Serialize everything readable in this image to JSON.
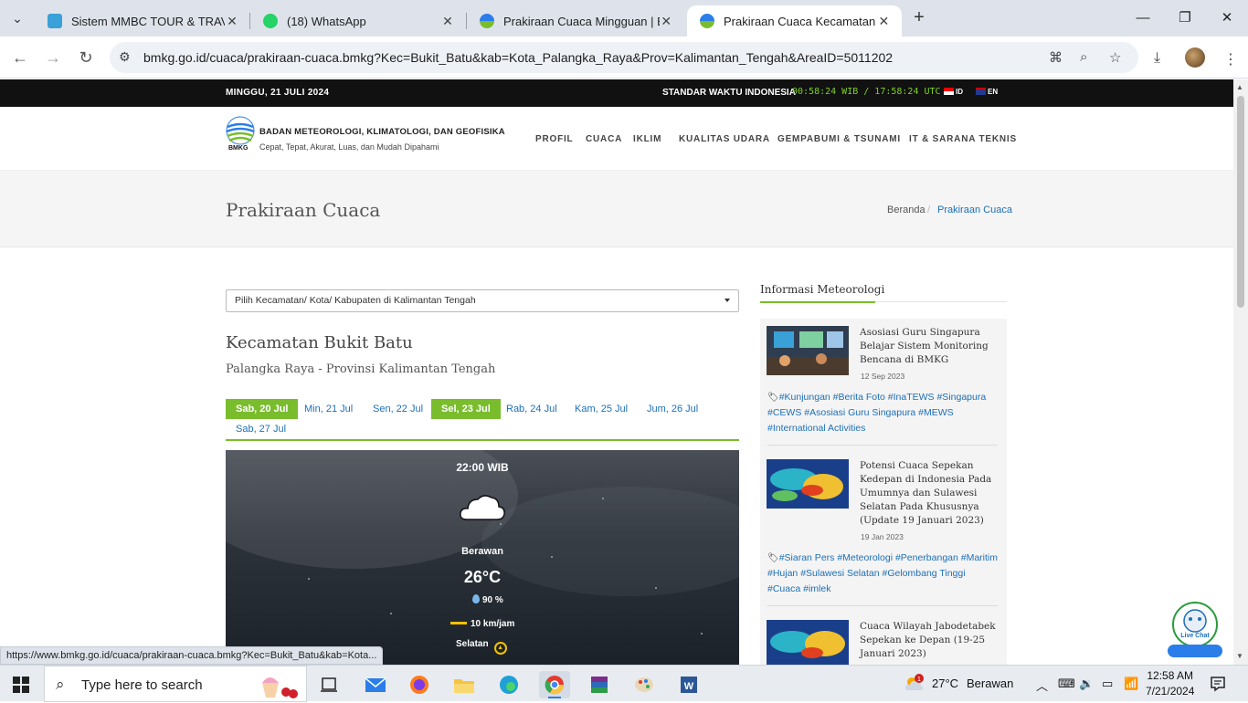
{
  "browser": {
    "tabs": [
      {
        "title": "Sistem MMBC TOUR & TRAVEL",
        "favicon": "mmbc-favicon"
      },
      {
        "title": "(18) WhatsApp",
        "favicon": "whatsapp-favicon"
      },
      {
        "title": "Prakiraan Cuaca Mingguan | BM",
        "favicon": "bmkg-favicon"
      },
      {
        "title": "Prakiraan Cuaca Kecamatan Buk",
        "favicon": "bmkg-favicon"
      }
    ],
    "active_tab": 3,
    "url": "bmkg.go.id/cuaca/prakiraan-cuaca.bmkg?Kec=Bukit_Batu&kab=Kota_Palangka_Raya&Prov=Kalimantan_Tengah&AreaID=5011202",
    "status_url": "https://www.bmkg.go.id/cuaca/prakiraan-cuaca.bmkg?Kec=Bukit_Batu&kab=Kota..."
  },
  "topbar": {
    "date": "MINGGU, 21 JULI 2024",
    "std_label": "STANDAR WAKTU INDONESIA",
    "clock": "00:58:24 WIB / 17:58:24 UTC",
    "lang_id": "ID",
    "lang_en": "EN"
  },
  "header": {
    "org_name": "BADAN METEOROLOGI, KLIMATOLOGI, DAN GEOFISIKA",
    "tagline": "Cepat, Tepat, Akurat, Luas, dan Mudah Dipahami",
    "logo_caption": "BMKG",
    "nav": [
      "PROFIL",
      "CUACA",
      "IKLIM",
      "KUALITAS UDARA",
      "GEMPABUMI & TSUNAMI",
      "IT & SARANA TEKNIS"
    ]
  },
  "page_title": {
    "title": "Prakiraan Cuaca",
    "breadcrumb": [
      "Beranda",
      "Prakiraan Cuaca"
    ]
  },
  "main": {
    "select_label": "Pilih Kecamatan/ Kota/ Kabupaten di Kalimantan Tengah",
    "kecamatan": "Kecamatan Bukit Batu",
    "province": "Palangka Raya - Provinsi Kalimantan Tengah",
    "day_tabs": [
      "Sab, 20 Jul",
      "Min, 21 Jul",
      "Sen, 22 Jul",
      "Sel, 23 Jul",
      "Rab, 24 Jul",
      "Kam, 25 Jul",
      "Jum, 26 Jul",
      "Sab, 27 Jul"
    ],
    "forecast": {
      "time": "22:00 WIB",
      "condition": "Berawan",
      "temperature": "26°C",
      "humidity": "90 %",
      "wind_speed": "10 km/jam",
      "wind_dir": "Selatan"
    }
  },
  "sidebar": {
    "heading": "Informasi Meteorologi",
    "news": [
      {
        "title": "Asosiasi Guru Singapura Belajar Sistem Monitoring Bencana di BMKG",
        "date": "12 Sep 2023",
        "tags": "#Kunjungan #Berita Foto #InaTEWS #Singapura #CEWS #Asosiasi Guru Singapura #MEWS #International Activities"
      },
      {
        "title": "Potensi Cuaca Sepekan Kedepan di Indonesia Pada Umumnya dan Sulawesi Selatan Pada Khususnya (Update 19 Januari 2023)",
        "date": "19 Jan 2023",
        "tags": "#Siaran Pers #Meteorologi #Penerbangan #Maritim #Hujan #Sulawesi Selatan #Gelombang Tinggi #Cuaca #imlek"
      },
      {
        "title": "Cuaca Wilayah Jabodetabek Sepekan ke Depan (19-25 Januari 2023)",
        "date": "",
        "tags": ""
      }
    ],
    "livechat": "Live Chat"
  },
  "taskbar": {
    "search_placeholder": "Type here to search",
    "weather_temp": "27°C",
    "weather_cond": "Berawan",
    "time": "12:58 AM",
    "date": "7/21/2024",
    "notif_count": "1"
  }
}
